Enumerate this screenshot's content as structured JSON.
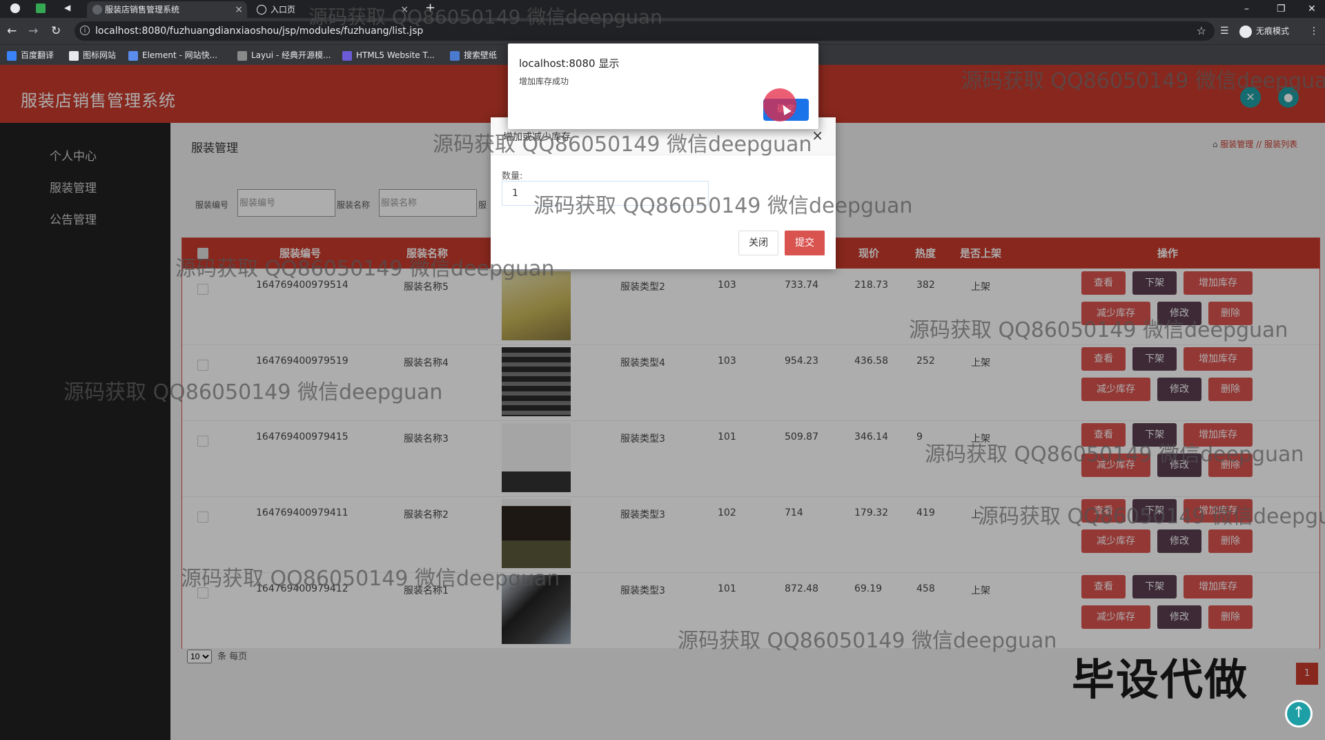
{
  "browser": {
    "tabs": [
      {
        "title": "服装店销售管理系统",
        "close": "×"
      },
      {
        "title": "入口页",
        "close": "×"
      }
    ],
    "new_tab": "+",
    "url": "localhost:8080/fuzhuangdianxiaoshou/jsp/modules/fuzhuang/list.jsp",
    "profile": "无痕模式",
    "bookmarks": [
      "百度翻译",
      "图标网站",
      "Element - 网站快...",
      "Layui - 经典开源模...",
      "HTML5 Website T...",
      "搜索壁纸"
    ]
  },
  "app": {
    "title": "服装店销售管理系统",
    "sidebar": [
      "个人中心",
      "服装管理",
      "公告管理"
    ],
    "page_title": "服装管理",
    "breadcrumb": "服装管理 // 服装列表",
    "filters": [
      {
        "label": "服装编号",
        "placeholder": "服装编号"
      },
      {
        "label": "服装名称",
        "placeholder": "服装名称"
      },
      {
        "label": "服",
        "placeholder": ""
      }
    ],
    "table": {
      "headers": [
        "服装编号",
        "服装名称",
        "现价",
        "热度",
        "是否上架",
        "操作"
      ],
      "rows": [
        {
          "id": "164769400979514",
          "name": "服装名称5",
          "type": "服装类型2",
          "stock": "103",
          "orig": "733.74",
          "price": "218.73",
          "hot": "382",
          "status": "上架"
        },
        {
          "id": "164769400979519",
          "name": "服装名称4",
          "type": "服装类型4",
          "stock": "103",
          "orig": "954.23",
          "price": "436.58",
          "hot": "252",
          "status": "上架"
        },
        {
          "id": "164769400979415",
          "name": "服装名称3",
          "type": "服装类型3",
          "stock": "101",
          "orig": "509.87",
          "price": "346.14",
          "hot": "9",
          "status": "上架"
        },
        {
          "id": "164769400979411",
          "name": "服装名称2",
          "type": "服装类型3",
          "stock": "102",
          "orig": "714",
          "price": "179.32",
          "hot": "419",
          "status": "上"
        },
        {
          "id": "164769400979412",
          "name": "服装名称1",
          "type": "服装类型3",
          "stock": "101",
          "orig": "872.48",
          "price": "69.19",
          "hot": "458",
          "status": "上架"
        }
      ],
      "actions": {
        "view": "查看",
        "off": "下架",
        "add_stock": "增加库存",
        "reduce_stock": "减少库存",
        "edit": "修改",
        "delete": "删除"
      }
    },
    "pager": {
      "page_size": "10",
      "suffix": "条 每页",
      "current_page": "1"
    }
  },
  "dialog": {
    "title": "增加或减少库存",
    "close": "×",
    "qty_label": "数量:",
    "qty_value": "1",
    "close_btn": "关闭",
    "submit_btn": "提交"
  },
  "alert": {
    "title": "localhost:8080 显示",
    "message": "增加库存成功",
    "ok": "确定"
  },
  "watermark": "源码获取 QQ86050149 微信deepguan",
  "promo": "毕设代做"
}
